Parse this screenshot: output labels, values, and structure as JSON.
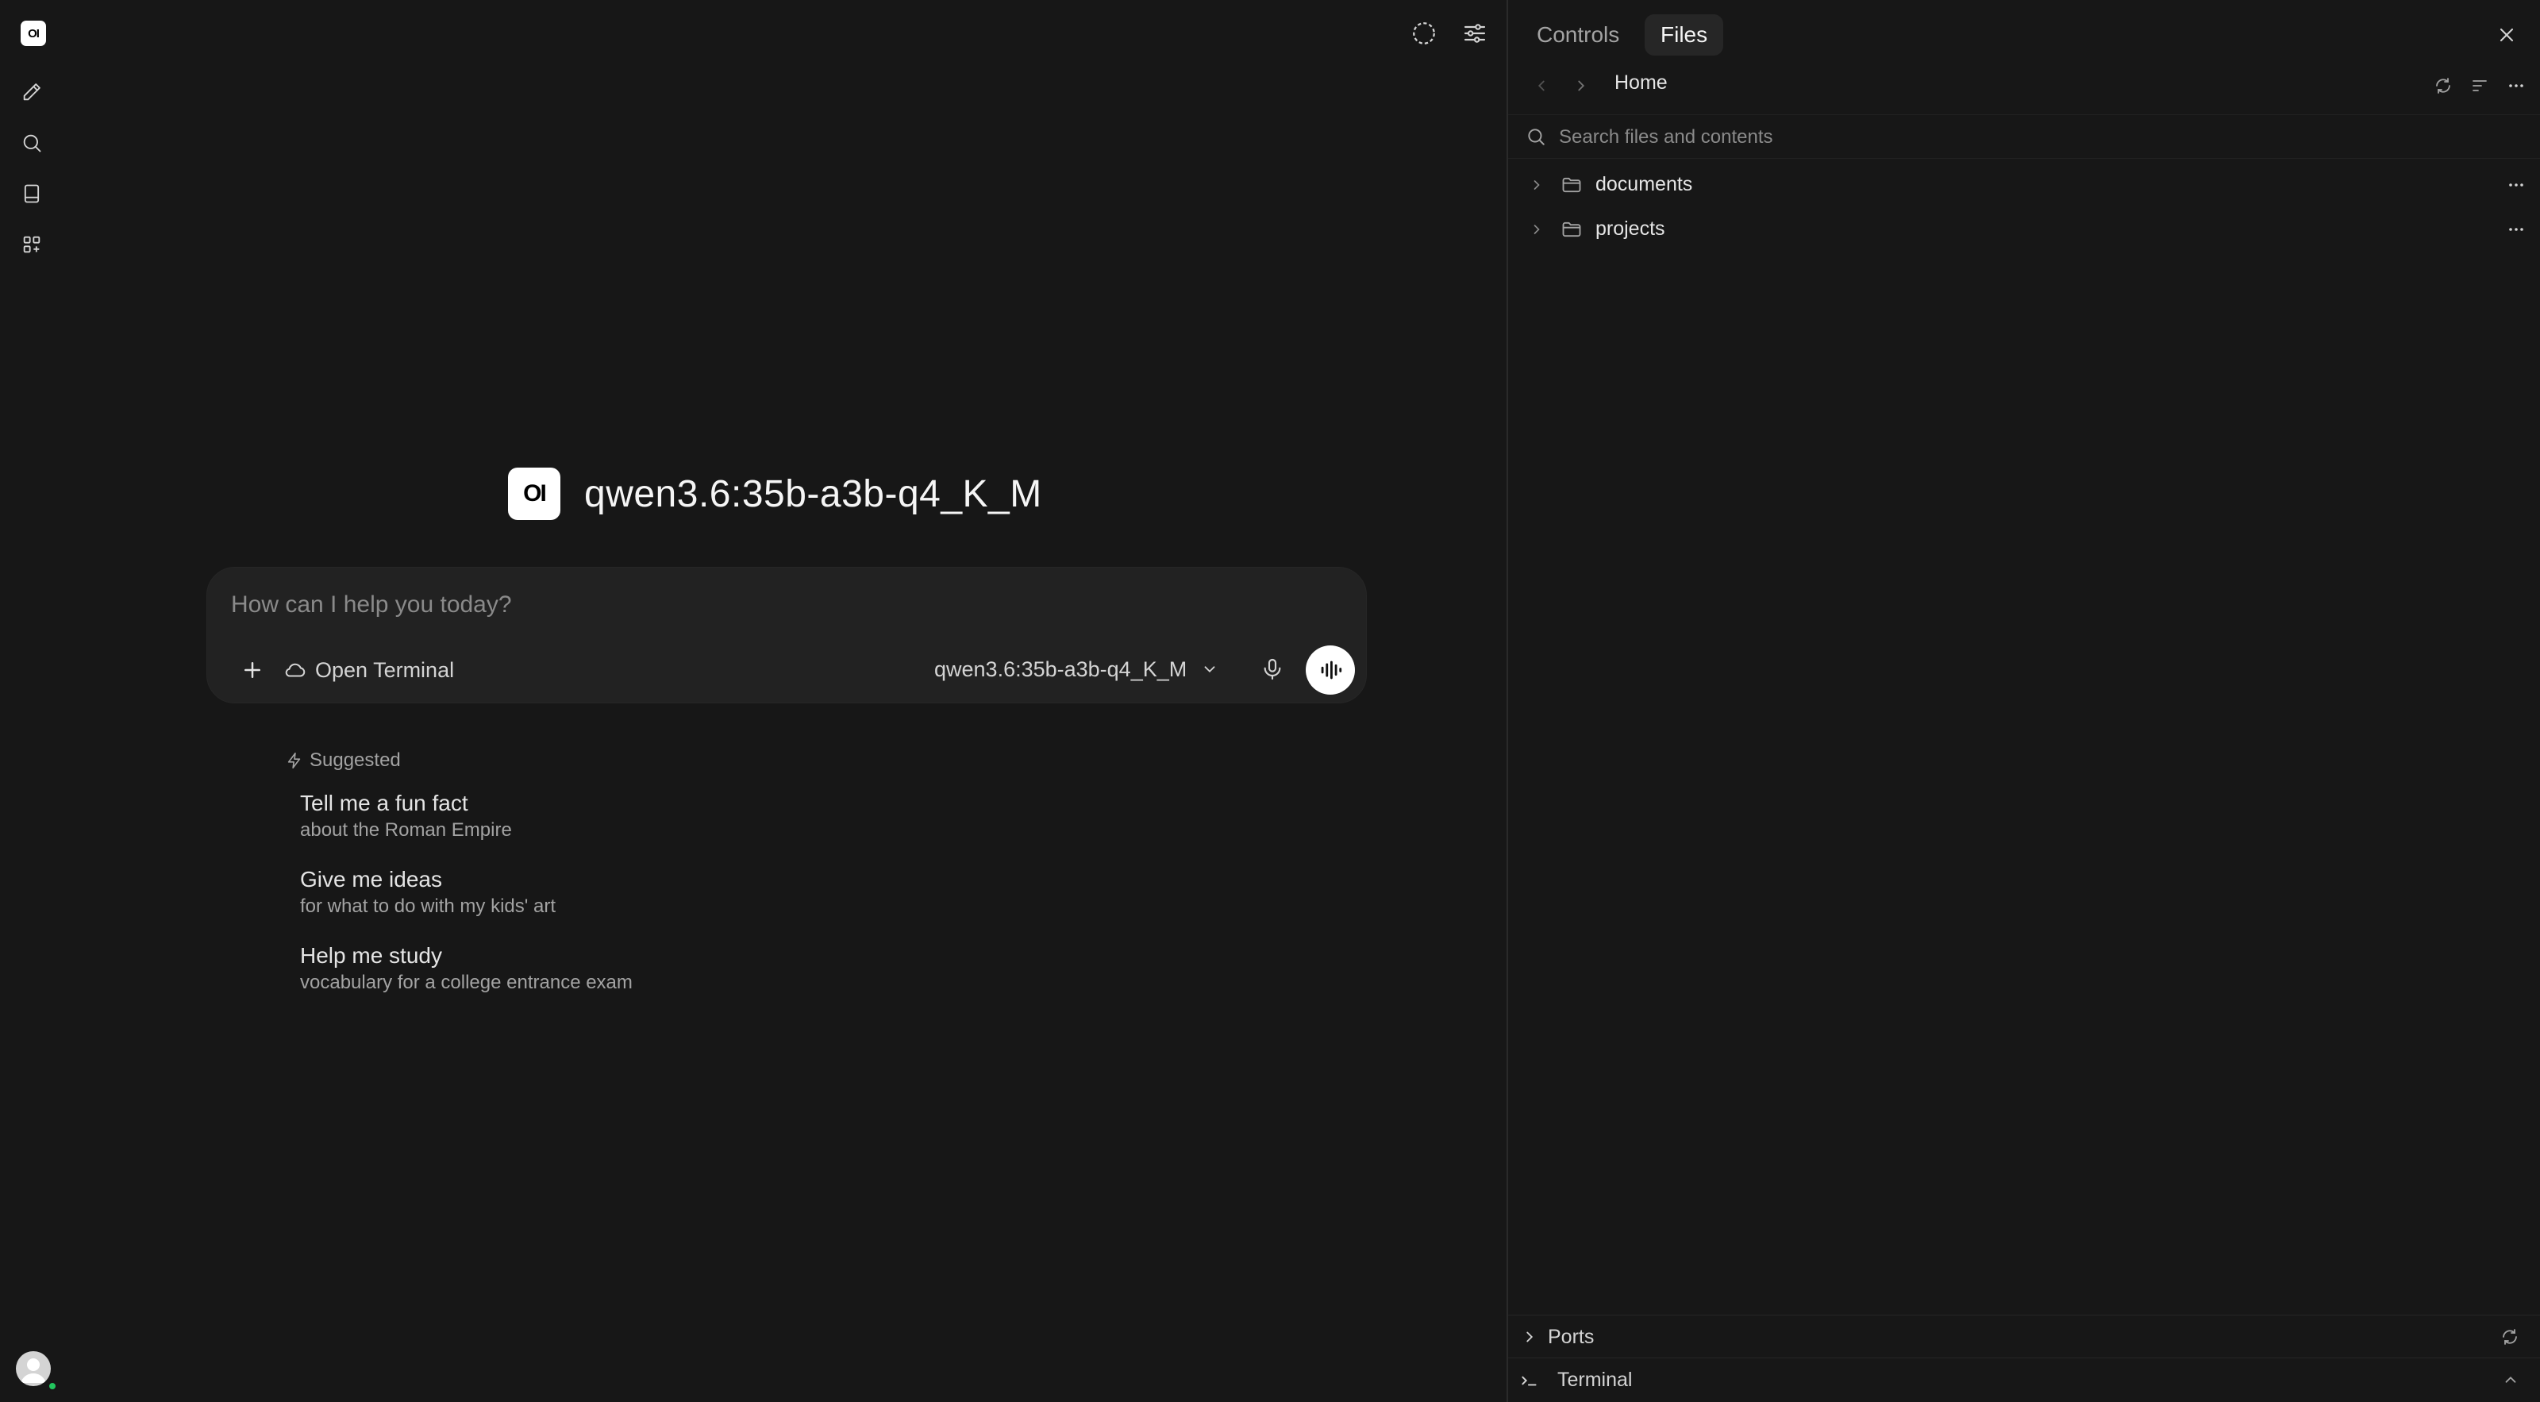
{
  "rail": {
    "logo_text": "OI",
    "icons": [
      "new-chat-icon",
      "search-icon",
      "notes-icon",
      "workspace-icon"
    ]
  },
  "header": {
    "icons": [
      "temporary-chat-icon",
      "controls-icon"
    ]
  },
  "hero": {
    "logo_text": "OI",
    "model_title": "qwen3.6:35b-a3b-q4_K_M"
  },
  "composer": {
    "placeholder": "How can I help you today?",
    "terminal_label": "Open Terminal",
    "model_selected": "qwen3.6:35b-a3b-q4_K_M"
  },
  "suggestions": {
    "heading": "Suggested",
    "items": [
      {
        "title": "Tell me a fun fact",
        "subtitle": "about the Roman Empire"
      },
      {
        "title": "Give me ideas",
        "subtitle": "for what to do with my kids' art"
      },
      {
        "title": "Help me study",
        "subtitle": "vocabulary for a college entrance exam"
      }
    ]
  },
  "panel": {
    "tabs": [
      {
        "label": "Controls",
        "active": false
      },
      {
        "label": "Files",
        "active": true
      }
    ],
    "breadcrumb": "Home",
    "search_placeholder": "Search files and contents",
    "tree": [
      {
        "name": "documents",
        "type": "folder"
      },
      {
        "name": "projects",
        "type": "folder"
      }
    ],
    "bottom": {
      "ports_label": "Ports",
      "terminal_label": "Terminal"
    }
  },
  "colors": {
    "background": "#171717",
    "surface": "#222222",
    "accent": "#ffffff",
    "online": "#22c55e"
  }
}
